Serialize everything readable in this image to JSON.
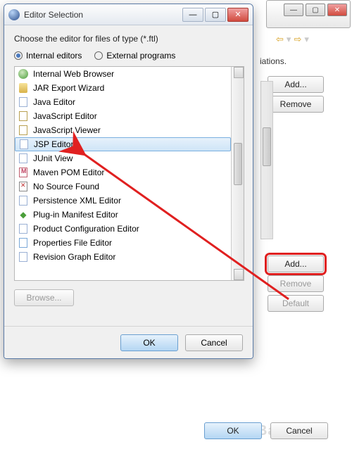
{
  "bg_window": {
    "nav": {
      "back": "⇦",
      "fwd": "⇨"
    },
    "text_fragment": "iations.",
    "buttons": {
      "add": "Add...",
      "remove": "Remove",
      "add2": "Add...",
      "remove2": "Remove",
      "default": "Default"
    },
    "bottom": {
      "ok": "OK",
      "cancel": "Cancel"
    }
  },
  "dialog": {
    "title": "Editor Selection",
    "win_ctrls": {
      "min": "—",
      "max": "▢",
      "close": "✕"
    },
    "prompt": "Choose the editor for files of type (*.ftl)",
    "radios": {
      "internal": "Internal editors",
      "external": "External programs"
    },
    "selected_radio": "internal",
    "items": [
      {
        "label": "Internal Web Browser",
        "icon": "globe-icon"
      },
      {
        "label": "JAR Export Wizard",
        "icon": "jar-icon"
      },
      {
        "label": "Java Editor",
        "icon": "doc-icon"
      },
      {
        "label": "JavaScript Editor",
        "icon": "js-icon"
      },
      {
        "label": "JavaScript Viewer",
        "icon": "js-icon"
      },
      {
        "label": "JSP Editor",
        "icon": "doc-icon",
        "selected": true
      },
      {
        "label": "JUnit View",
        "icon": "doc-icon"
      },
      {
        "label": "Maven POM Editor",
        "icon": "maven-icon"
      },
      {
        "label": "No Source Found",
        "icon": "nosource-icon"
      },
      {
        "label": "Persistence XML Editor",
        "icon": "doc-icon"
      },
      {
        "label": "Plug-in Manifest Editor",
        "icon": "plug-icon"
      },
      {
        "label": "Product Configuration Editor",
        "icon": "doc-icon"
      },
      {
        "label": "Properties File Editor",
        "icon": "prop-icon"
      },
      {
        "label": "Revision Graph Editor",
        "icon": "doc-icon"
      }
    ],
    "browse": "Browse...",
    "buttons": {
      "ok": "OK",
      "cancel": "Cancel"
    }
  },
  "watermark": "Baidu百度"
}
